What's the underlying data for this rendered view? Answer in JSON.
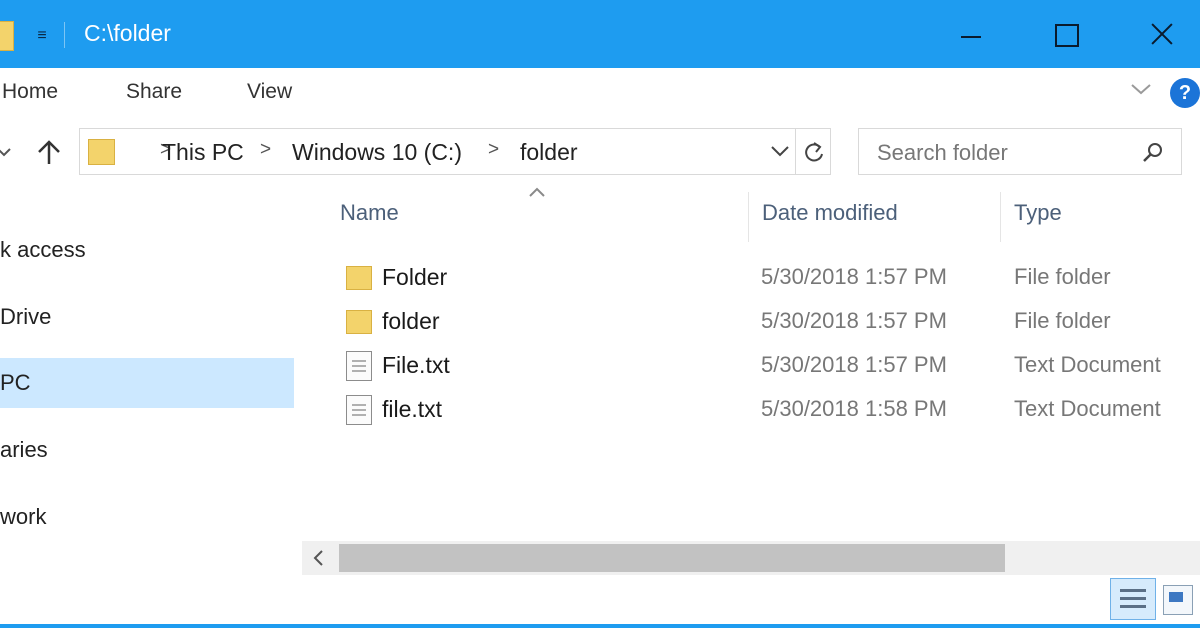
{
  "window": {
    "title": "C:\\folder",
    "controls": {
      "minimize": "minimize",
      "maximize": "maximize",
      "close": "close"
    }
  },
  "ribbon": {
    "tabs": [
      "Home",
      "Share",
      "View"
    ],
    "help_label": "?"
  },
  "address_bar": {
    "crumbs": [
      "This PC",
      "Windows 10 (C:)",
      "folder"
    ],
    "separator": ">"
  },
  "search": {
    "placeholder": "Search folder"
  },
  "nav_pane": {
    "items": [
      {
        "label": "k access",
        "selected": false
      },
      {
        "label": "Drive",
        "selected": false
      },
      {
        "label": "PC",
        "selected": true
      },
      {
        "label": "aries",
        "selected": false
      },
      {
        "label": "work",
        "selected": false
      }
    ]
  },
  "file_list": {
    "columns": [
      "Name",
      "Date modified",
      "Type"
    ],
    "rows": [
      {
        "icon": "folder-icon",
        "name": "Folder",
        "date": "5/30/2018 1:57 PM",
        "type": "File folder"
      },
      {
        "icon": "folder-icon",
        "name": "folder",
        "date": "5/30/2018 1:57 PM",
        "type": "File folder"
      },
      {
        "icon": "text-file-icon",
        "name": "File.txt",
        "date": "5/30/2018 1:57 PM",
        "type": "Text Document"
      },
      {
        "icon": "text-file-icon",
        "name": "file.txt",
        "date": "5/30/2018 1:58 PM",
        "type": "Text Document"
      }
    ]
  },
  "colors": {
    "titlebar": "#1e9cf0",
    "selection": "#cce8ff",
    "folder": "#f3d36b"
  }
}
